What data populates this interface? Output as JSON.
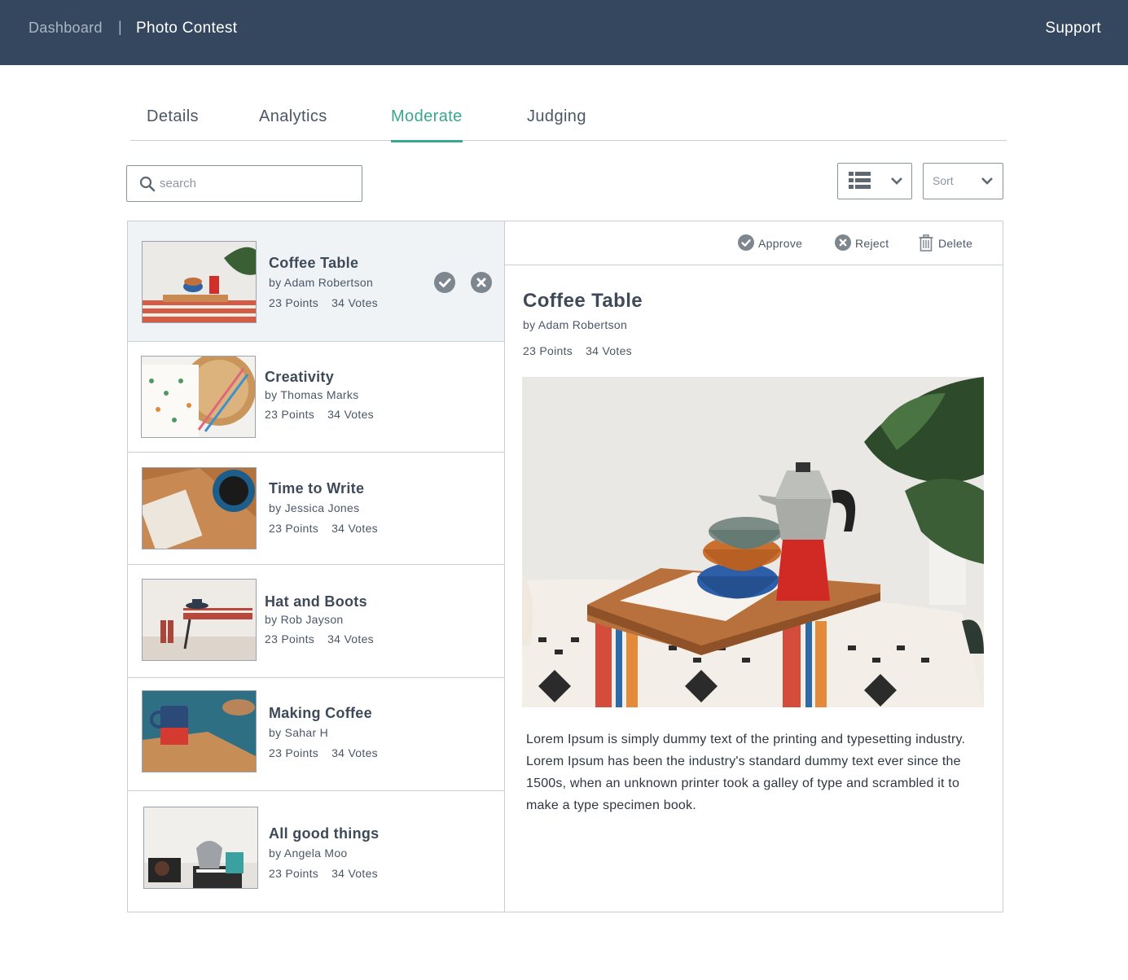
{
  "nav": {
    "dashboard": "Dashboard",
    "separator": "|",
    "title": "Photo Contest",
    "support": "Support"
  },
  "tabs": [
    {
      "label": "Details"
    },
    {
      "label": "Analytics"
    },
    {
      "label": "Moderate",
      "active": true
    },
    {
      "label": "Judging"
    }
  ],
  "search": {
    "placeholder": "search",
    "value": ""
  },
  "toolbar": {
    "view_icon": "list-icon",
    "sort_label": "Sort"
  },
  "entries": [
    {
      "title": "Coffee Table",
      "author": "by Adam Robertson",
      "points": "23 Points",
      "votes": "34 Votes",
      "selected": true
    },
    {
      "title": "Creativity",
      "author": "by Thomas Marks",
      "points": "23 Points",
      "votes": "34 Votes"
    },
    {
      "title": "Time to Write",
      "author": "by Jessica Jones",
      "points": "23 Points",
      "votes": "34 Votes"
    },
    {
      "title": "Hat and Boots",
      "author": "by Rob Jayson",
      "points": "23 Points",
      "votes": "34 Votes"
    },
    {
      "title": "Making Coffee",
      "author": "by Sahar H",
      "points": "23 Points",
      "votes": "34 Votes"
    },
    {
      "title": "All good things",
      "author": "by Angela Moo",
      "points": "23 Points",
      "votes": "34 Votes"
    }
  ],
  "detail": {
    "actions": {
      "approve": "Approve",
      "reject": "Reject",
      "delete": "Delete"
    },
    "title": "Coffee Table",
    "author": "by Adam Robertson",
    "points": "23 Points",
    "votes": "34 Votes",
    "description": "Lorem Ipsum is simply dummy text of the printing and typesetting industry. Lorem Ipsum has been the industry's standard dummy text ever since the 1500s, when an unknown printer took a galley of type and scrambled it to make a type specimen book."
  },
  "colors": {
    "header_bg": "#34475e",
    "accent": "#3aa68f",
    "selected_row": "#eff3f6",
    "icon_gray": "#7e8790"
  }
}
